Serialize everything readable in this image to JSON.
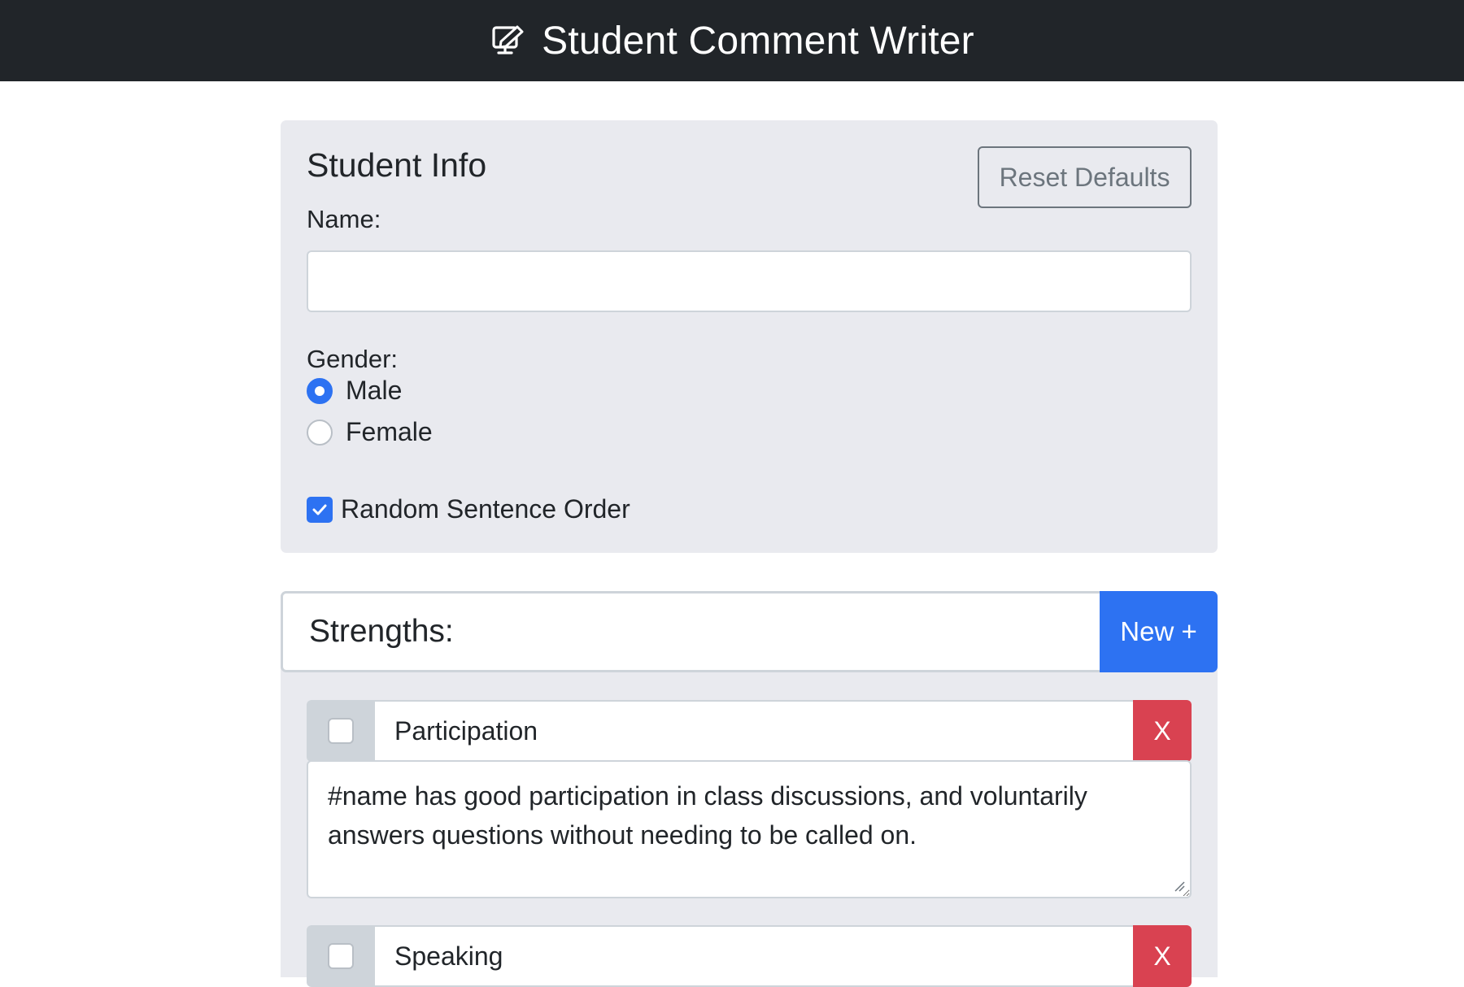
{
  "navbar": {
    "icon": "comment-writer-icon",
    "title": "Student Comment Writer"
  },
  "student_info": {
    "title": "Student Info",
    "reset_label": "Reset Defaults",
    "name_label": "Name:",
    "name_value": "",
    "gender_label": "Gender:",
    "gender_options": [
      {
        "label": "Male",
        "selected": true
      },
      {
        "label": "Female",
        "selected": false
      }
    ],
    "random_order_label": "Random Sentence Order",
    "random_order_checked": true
  },
  "strengths": {
    "title": "Strengths:",
    "new_label": "New +",
    "items": [
      {
        "title": "Participation",
        "checked": false,
        "delete_label": "X",
        "text": "#name has good participation in class discussions, and voluntarily answers questions without needing to be called on."
      },
      {
        "title": "Speaking",
        "checked": false,
        "delete_label": "X",
        "text": ""
      }
    ]
  },
  "colors": {
    "navbar_bg": "#212529",
    "card_bg": "#e9eaef",
    "primary": "#2d72f2",
    "danger": "#d94251",
    "secondary": "#6c757d"
  }
}
